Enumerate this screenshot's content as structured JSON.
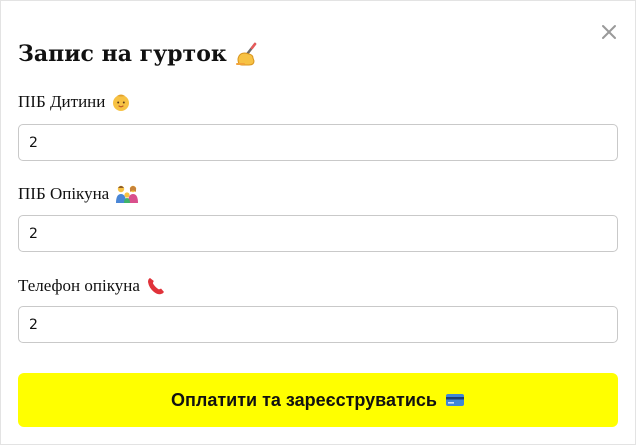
{
  "modal": {
    "title": "Запис на гурток",
    "title_icon": "writing-hand-icon",
    "close_icon": "close-icon"
  },
  "fields": [
    {
      "label": "ПІБ Дитини",
      "icon": "baby-icon",
      "value": "2"
    },
    {
      "label": "ПІБ Опікуна",
      "icon": "family-icon",
      "value": "2"
    },
    {
      "label": "Телефон опікуна",
      "icon": "telephone-receiver-icon",
      "value": "2"
    }
  ],
  "submit": {
    "label": "Оплатити та зареєструватись",
    "icon": "credit-card-icon",
    "background": "#ffff00"
  }
}
